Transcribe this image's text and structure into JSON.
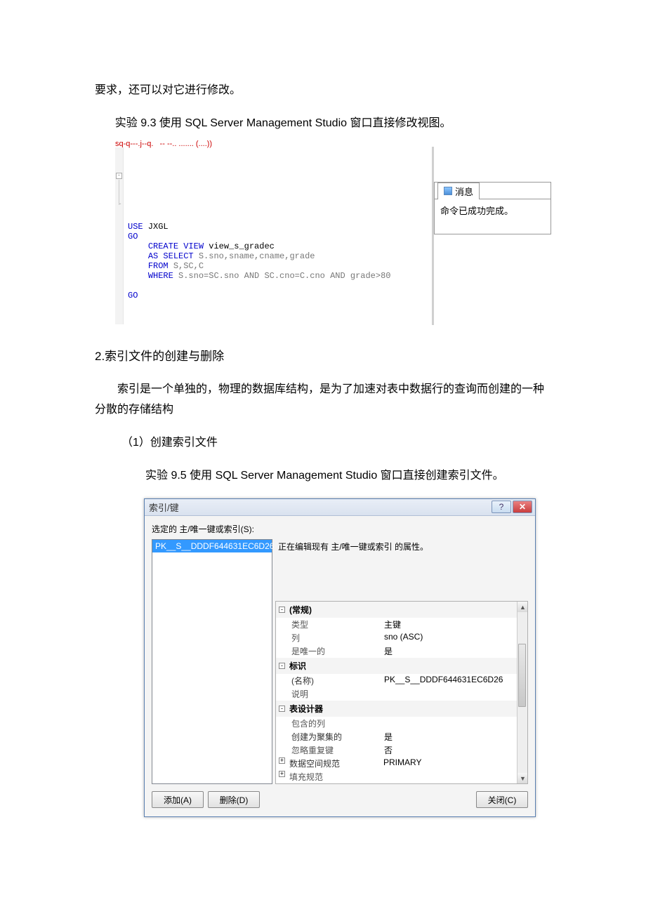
{
  "text": {
    "p1": "要求，还可以对它进行修改。",
    "exp93": "实验 9.3    使用 SQL Server Management Studio  窗口直接修改视图。",
    "section2": "2.索引文件的创建与删除",
    "p2": "索引是一个单独的，物理的数据库结构，是为了加速对表中数据行的查询而创建的一种分散的存储结构",
    "p3": "（1）创建索引文件",
    "exp95": "实验 9.5    使用 SQL Server Management Studio  窗口直接创建索引文件。"
  },
  "sql": {
    "header_garble": "sq-q---.j--q.   -- --.. ....... (....))",
    "t_use": "USE",
    "t_db": " JXGL",
    "t_go1": "GO",
    "t_create": "CREATE",
    "t_view": " VIEW",
    "t_viewname": " view_s_gradec",
    "t_as": "AS",
    "t_select": " SELECT",
    "t_cols": " S.sno,sname,cname,grade",
    "t_from": "FROM",
    "t_tables": " S,SC,C",
    "t_where": "WHERE",
    "t_cond": " S.sno=SC.sno AND SC.cno=C.cno AND grade>80",
    "t_go2": "GO"
  },
  "msg": {
    "tab": "消息",
    "body": "命令已成功完成。"
  },
  "dlg": {
    "title": "索引/键",
    "help": "?",
    "close": "✕",
    "label": "选定的 主/唯一键或索引(S):",
    "selected": "PK__S__DDDF644631EC6D26",
    "desc": "正在编辑现有 主/唯一键或索引 的属性。",
    "cats": {
      "c1": "(常规)",
      "c2": "标识",
      "c3": "表设计器"
    },
    "props": {
      "type_k": "类型",
      "type_v": "主键",
      "col_k": "列",
      "col_v": "sno (ASC)",
      "uniq_k": "是唯一的",
      "uniq_v": "是",
      "name_k": "(名称)",
      "name_v": "PK__S__DDDF644631EC6D26",
      "spec_k": "说明",
      "spec_v": "",
      "inc_k": "包含的列",
      "inc_v": "",
      "clus_k": "创建为聚集的",
      "clus_v": "是",
      "dup_k": "忽略重复键",
      "dup_v": "否",
      "space_k": "数据空间规范",
      "space_v": "PRIMARY",
      "fill_k": "填充规范",
      "fill_v": ""
    },
    "btn_add": "添加(A)",
    "btn_del": "删除(D)",
    "btn_close": "关闭(C)"
  }
}
